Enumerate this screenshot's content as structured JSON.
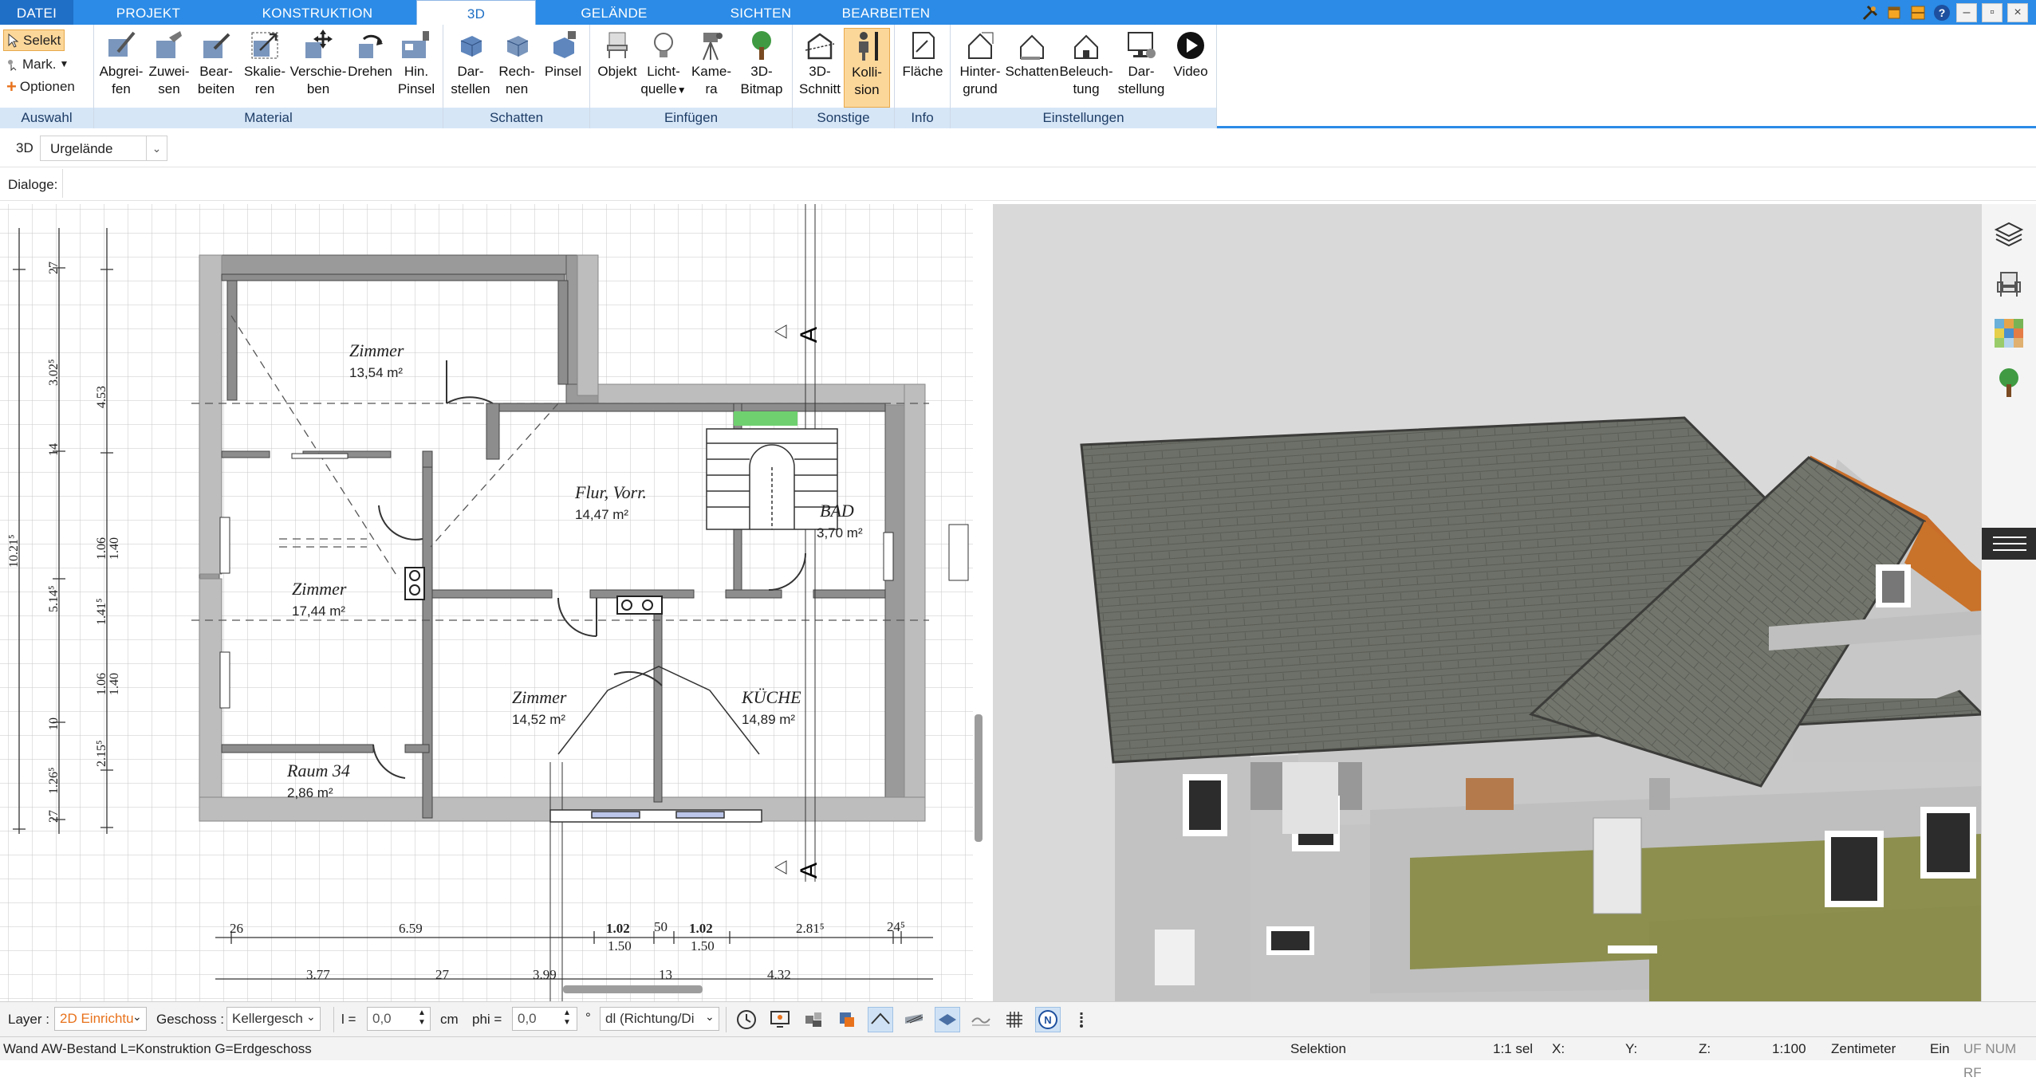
{
  "tabs": [
    "DATEI",
    "PROJEKT",
    "KONSTRUKTION",
    "3D",
    "GELÄNDE",
    "SICHTEN",
    "BEARBEITEN"
  ],
  "ribbon": {
    "auswahl": {
      "select": "Selekt",
      "mark": "Mark.",
      "optionen": "Optionen",
      "label": "Auswahl"
    },
    "material": {
      "label": "Material",
      "buttons": [
        [
          "Abgrei-",
          "fen"
        ],
        [
          "Zuwei-",
          "sen"
        ],
        [
          "Bear-",
          "beiten"
        ],
        [
          "Skalie-",
          "ren"
        ],
        [
          "Verschie-",
          "ben"
        ],
        [
          "Drehen",
          ""
        ],
        [
          "Hin.",
          "Pinsel"
        ]
      ]
    },
    "schatten": {
      "label": "Schatten",
      "buttons": [
        [
          "Dar-",
          "stellen"
        ],
        [
          "Rech-",
          "nen"
        ],
        [
          "Pinsel",
          ""
        ]
      ]
    },
    "einfuegen": {
      "label": "Einfügen",
      "buttons": [
        [
          "Objekt",
          ""
        ],
        [
          "Licht-",
          "quelle"
        ],
        [
          "Kame-",
          "ra"
        ],
        [
          "3D-",
          "Bitmap"
        ]
      ]
    },
    "sonstige": {
      "label": "Sonstige",
      "buttons": [
        [
          "3D-",
          "Schnitt"
        ],
        [
          "Kolli-",
          "sion"
        ]
      ]
    },
    "info": {
      "label": "Info",
      "buttons": [
        [
          "Fläche",
          ""
        ]
      ]
    },
    "einstellungen": {
      "label": "Einstellungen",
      "buttons": [
        [
          "Hinter-",
          "grund"
        ],
        [
          "Schatten",
          ""
        ],
        [
          "Beleuch-",
          "tung"
        ],
        [
          "Dar-",
          "stellung"
        ],
        [
          "Video",
          ""
        ]
      ]
    }
  },
  "viewbar": {
    "mode": "3D",
    "terrain": "Urgelände"
  },
  "dialogs": {
    "label": "Dialoge:"
  },
  "plan": {
    "rooms": [
      {
        "name": "Zimmer",
        "area": "13,54 m²"
      },
      {
        "name": "Flur, Vorr.",
        "area": "14,47 m²"
      },
      {
        "name": "BAD",
        "area": "3,70 m²"
      },
      {
        "name": "Zimmer",
        "area": "17,44 m²"
      },
      {
        "name": "Zimmer",
        "area": "14,52 m²"
      },
      {
        "name": "KÜCHE",
        "area": "14,89 m²"
      },
      {
        "name": "Raum 34",
        "area": "2,86 m²"
      }
    ],
    "section_mark": "A",
    "dims_left": [
      "27",
      "3.02⁵",
      "4.53",
      "14",
      "10.21⁵",
      "1.06",
      "1.40",
      "5.14⁵",
      "1.41⁵",
      "1.06",
      "1.40",
      "10",
      "2.15⁵",
      "1.26⁵",
      "27"
    ],
    "dims_bottom": [
      "26",
      "6.59",
      "1.02",
      "1.50",
      "50",
      "1.02",
      "1.50",
      "2.81⁵",
      "24⁵",
      "3.77",
      "27",
      "3.99",
      "13",
      "4.32"
    ]
  },
  "toolbar": {
    "layer_label": "Layer :",
    "layer_value": "2D Einrichtu",
    "geschoss_label": "Geschoss :",
    "geschoss_value": "Kellergesch",
    "l_label": "l =",
    "l_value": "0,0",
    "l_unit": "cm",
    "phi_label": "phi =",
    "phi_value": "0,0",
    "phi_unit": "°",
    "dir_value": "dl (Richtung/Di"
  },
  "status": {
    "left": "Wand AW-Bestand L=Konstruktion G=Erdgeschoss",
    "mode": "Selektion",
    "sel": "1:1 sel",
    "x": "X:",
    "y": "Y:",
    "z": "Z:",
    "scale": "1:100",
    "unit": "Zentimeter",
    "ein": "Ein",
    "flags": "UF NUM RF"
  },
  "colors": {
    "accent": "#2b8be6",
    "active_button": "#fcd79a",
    "group_label_bg": "#d6e6f7"
  }
}
